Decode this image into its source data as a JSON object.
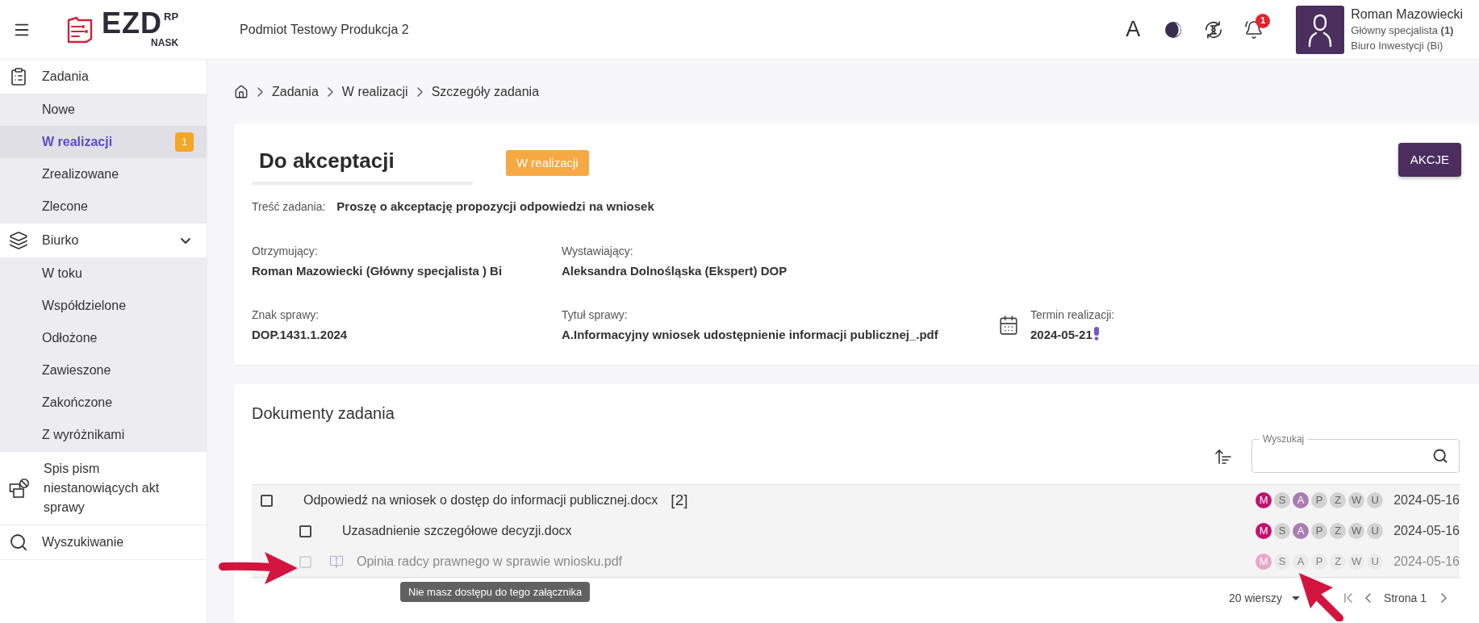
{
  "header": {
    "logo": {
      "name": "EZD",
      "superscript": "RP",
      "subtitle": "NASK"
    },
    "organization": "Podmiot Testowy Produkcja 2",
    "text_size_button": "A",
    "notification_count": "1",
    "user": {
      "name": "Roman Mazowiecki",
      "role": "Główny specjalista **(1)**",
      "department": "Biuro Inwestycji (Bi)"
    }
  },
  "sidebar": {
    "items": [
      {
        "label": "Zadania",
        "selected": false,
        "children": [
          {
            "label": "Nowe",
            "selected": false
          },
          {
            "label": "W realizacji",
            "selected": true,
            "badge": "1"
          },
          {
            "label": "Zrealizowane",
            "selected": false
          },
          {
            "label": "Zlecone",
            "selected": false
          }
        ]
      },
      {
        "label": "Biurko",
        "selected": false,
        "expanded": true,
        "children": [
          {
            "label": "W toku",
            "selected": false
          },
          {
            "label": "Współdzielone",
            "selected": false
          },
          {
            "label": "Odłożone",
            "selected": false
          },
          {
            "label": "Zawieszone",
            "selected": false
          },
          {
            "label": "Zakończone",
            "selected": false
          },
          {
            "label": "Z wyróżnikami",
            "selected": false
          }
        ]
      },
      {
        "label": "Spis pism niestanowiących akt sprawy",
        "selected": false
      },
      {
        "label": "Wyszukiwanie",
        "selected": false
      }
    ]
  },
  "breadcrumb": [
    "Zadania",
    "W realizacji",
    "Szczegóły zadania"
  ],
  "task": {
    "title": "Do akceptacji",
    "status": "W realizacji",
    "action_button": "AKCJE",
    "content": {
      "label": "Treść zadania:",
      "value": "Proszę o akceptację propozycji odpowiedzi na wniosek"
    },
    "details": [
      [
        {
          "kind": "text",
          "label": "Otrzymujący:",
          "value": "Roman Mazowiecki (Główny specjalista ) Bi"
        },
        {
          "kind": "text",
          "label": "Wystawiający:",
          "value": "Aleksandra Dolnośląska (Ekspert) DOP"
        }
      ],
      [
        {
          "kind": "text",
          "label": "Znak sprawy:",
          "value": "DOP.1431.1.2024"
        },
        {
          "kind": "text",
          "label": "Tytuł sprawy:",
          "value": "A.Informacyjny wniosek udostępnienie informacji publicznej_.pdf"
        },
        {
          "kind": "date",
          "label": "Termin realizacji:",
          "value": "2024-05-21",
          "warning": true
        }
      ]
    ]
  },
  "documents": {
    "title": "Dokumenty zadania",
    "search": {
      "label": "Wyszukaj"
    },
    "rows": [
      {
        "name": "Odpowiedź na wniosek o dostęp do informacji publicznej.docx",
        "count": "[2]",
        "kind": "document",
        "checked": false,
        "disabled": false,
        "markers": [
          {
            "letter": "M",
            "color": "#c2116f"
          },
          {
            "letter": "S",
            "color": "#d3d3d3"
          },
          {
            "letter": "A",
            "color": "#a87eb2"
          },
          {
            "letter": "P",
            "color": "#d3d3d3"
          },
          {
            "letter": "Z",
            "color": "#d3d3d3"
          },
          {
            "letter": "W",
            "color": "#d3d3d3"
          },
          {
            "letter": "U",
            "color": "#d3d3d3"
          }
        ],
        "date": "2024-05-16",
        "children": [
          {
            "name": "Uzasadnienie szczegółowe decyzji.docx",
            "kind": "document",
            "checked": false,
            "disabled": false,
            "markers": [
              {
                "letter": "M",
                "color": "#c2116f"
              },
              {
                "letter": "S",
                "color": "#d3d3d3"
              },
              {
                "letter": "A",
                "color": "#a87eb2"
              },
              {
                "letter": "P",
                "color": "#d3d3d3"
              },
              {
                "letter": "Z",
                "color": "#d3d3d3"
              },
              {
                "letter": "W",
                "color": "#d3d3d3"
              },
              {
                "letter": "U",
                "color": "#d3d3d3"
              }
            ],
            "date": "2024-05-16"
          },
          {
            "name": "Opinia radcy prawnego w sprawie wniosku.pdf",
            "kind": "attachment",
            "checked": false,
            "disabled": true,
            "markers": [
              {
                "letter": "M",
                "color": "#eba4c9"
              },
              {
                "letter": "S",
                "color": "#ebebeb"
              },
              {
                "letter": "A",
                "color": "#ebebeb"
              },
              {
                "letter": "P",
                "color": "#ebebeb"
              },
              {
                "letter": "Z",
                "color": "#ebebeb"
              },
              {
                "letter": "W",
                "color": "#ebebeb"
              },
              {
                "letter": "U",
                "color": "#ebebeb"
              }
            ],
            "date": "2024-05-16"
          }
        ]
      }
    ],
    "tooltip": "Nie masz dostępu do tego załącznika",
    "pagination": {
      "rows_per_page": "20 wierszy",
      "page": "Strona 1"
    }
  }
}
